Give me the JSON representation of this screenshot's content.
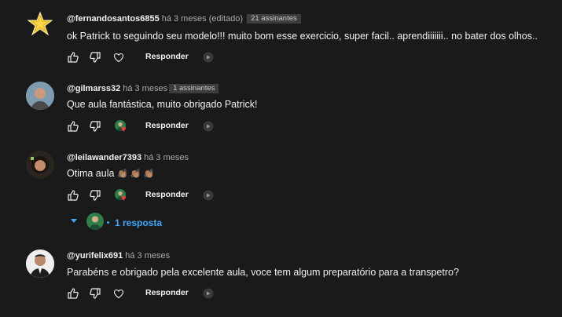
{
  "comments": [
    {
      "author": "@fernandosantos6855",
      "time": "há 3 meses (editado)",
      "badge": "21 assinantes",
      "text": "ok  Patrick to seguindo seu modelo!!!  muito bom esse exercicio, super facil.. aprendiiiiiii.. no bater dos olhos..",
      "reply_label": "Responder",
      "creator_heart": false
    },
    {
      "author": "@gilmarss32",
      "time": "há 3 meses",
      "badge": "1 assinantes",
      "text": "Que aula fantástica, muito obrigado Patrick!",
      "reply_label": "Responder",
      "creator_heart": true
    },
    {
      "author": "@leilawander7393",
      "time": "há 3 meses",
      "text": "Otima aula",
      "emojis": "👏🏽 👏🏽 👏🏽",
      "reply_label": "Responder",
      "creator_heart": true,
      "replies_label": "1 resposta"
    },
    {
      "author": "@yurifelix691",
      "time": "há 3 meses",
      "text": "Parabéns e obrigado pela excelente aula, voce tem algum preparatório para a transpetro?",
      "reply_label": "Responder",
      "creator_heart": false
    }
  ],
  "colors": {
    "background": "#1a1a1a",
    "text": "#f1f1f1",
    "secondary_text": "#aaaaaa",
    "link": "#3ea6ff",
    "heart": "#ff3838"
  },
  "icons": [
    "like-icon",
    "dislike-icon",
    "heart-outline-icon",
    "creator-heart-icon",
    "share-icon",
    "chevron-down-icon"
  ]
}
